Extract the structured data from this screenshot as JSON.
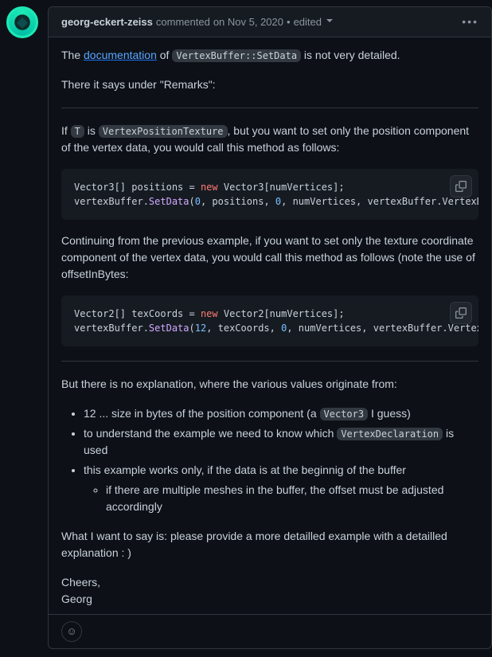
{
  "header": {
    "author": "georg-eckert-zeiss",
    "action": "commented",
    "timestamp": "on Nov 5, 2020",
    "edited_label": "edited"
  },
  "body": {
    "p1_prefix": "The ",
    "p1_link": "documentation",
    "p1_mid": " of ",
    "p1_code": "VertexBuffer::SetData",
    "p1_suffix": " is not very detailed.",
    "p2": "There it says under \"Remarks\":",
    "p3_prefix": "If ",
    "p3_code1": "T",
    "p3_mid1": " is ",
    "p3_code2": "VertexPositionTexture",
    "p3_suffix": ", but you want to set only the position component of the vertex data, you would call this method as follows:",
    "code1": "Vector3[] positions = new Vector3[numVertices];\nvertexBuffer.SetData(0, positions, 0, numVertices, vertexBuffer.VertexDeclaration.VertexStride);",
    "p4": "Continuing from the previous example, if you want to set only the texture coordinate component of the vertex data, you would call this method as follows (note the use of offsetInBytes:",
    "code2": "Vector2[] texCoords = new Vector2[numVertices];\nvertexBuffer.SetData(12, texCoords, 0, numVertices, vertexBuffer.VertexDeclaration.VertexStride);",
    "p5": "But there is no explanation, where the various values originate from:",
    "bullets": {
      "b1_prefix": "12 ... size in bytes of the position component (a ",
      "b1_code": "Vector3",
      "b1_suffix": " I guess)",
      "b2_prefix": "to understand the example we need to know which ",
      "b2_code": "VertexDeclaration",
      "b2_suffix": " is used",
      "b3": "this example works only, if the data is at the beginnig of the buffer",
      "b3_sub": "if there are multiple meshes in the buffer, the offset must be adjusted accordingly"
    },
    "p6": "What I want to say is: please provide a more detailled example with a detailled explanation : )",
    "p7": "Cheers,",
    "p8": "Georg"
  }
}
